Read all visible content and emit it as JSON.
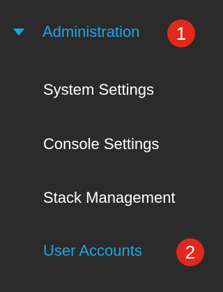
{
  "menu": {
    "section": {
      "label": "Administration",
      "expanded": true,
      "icon": "caret-down-icon"
    },
    "items": [
      {
        "label": "System Settings",
        "active": false
      },
      {
        "label": "Console Settings",
        "active": false
      },
      {
        "label": "Stack Management",
        "active": false
      },
      {
        "label": "User Accounts",
        "active": true
      }
    ]
  },
  "callouts": [
    {
      "label": "1"
    },
    {
      "label": "2"
    }
  ],
  "colors": {
    "background": "#2b2b2b",
    "accent": "#1fa5e6",
    "text": "#ffffff",
    "badge": "#e0291c"
  }
}
